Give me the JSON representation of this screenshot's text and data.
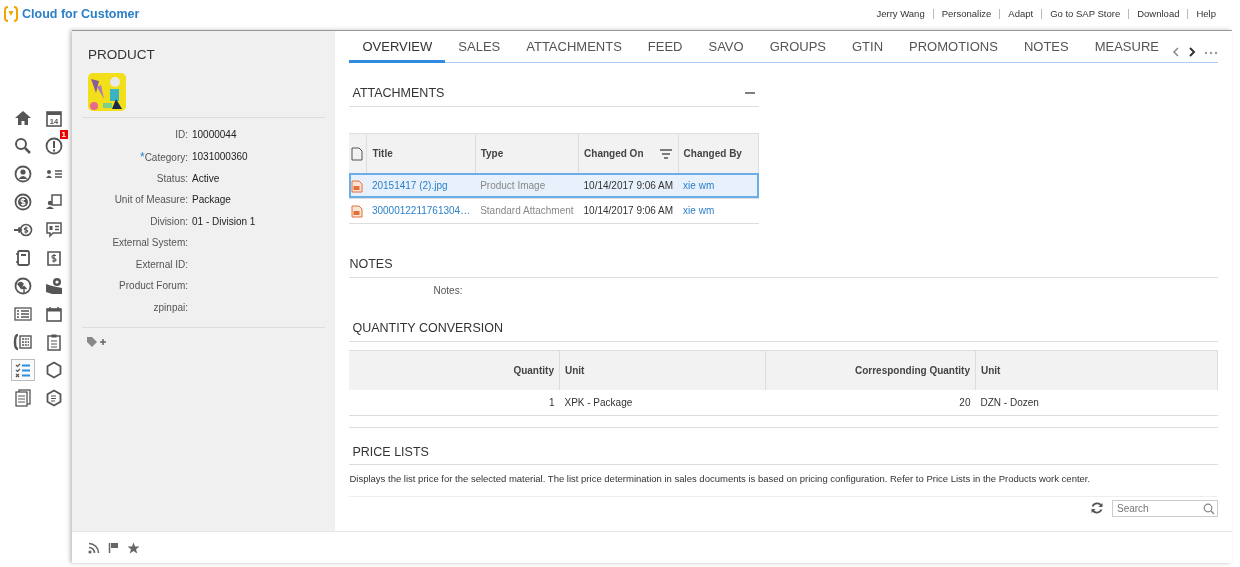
{
  "header": {
    "app_title": "Cloud for Customer",
    "links": [
      "Jerry Wang",
      "Personalize",
      "Adapt",
      "Go to SAP Store",
      "Download",
      "Help"
    ]
  },
  "sidebar": {
    "items": [
      {
        "kind": "home",
        "selected": false
      },
      {
        "kind": "calendar",
        "selected": false,
        "date": "14"
      },
      {
        "kind": "search",
        "selected": false
      },
      {
        "kind": "alert",
        "selected": false,
        "badge": "1"
      },
      {
        "kind": "person",
        "selected": false
      },
      {
        "kind": "people-list",
        "selected": false
      },
      {
        "kind": "money",
        "selected": false
      },
      {
        "kind": "person-chart",
        "selected": false
      },
      {
        "kind": "money-in",
        "selected": false
      },
      {
        "kind": "chat-money",
        "selected": false
      },
      {
        "kind": "notebook",
        "selected": false
      },
      {
        "kind": "money-doc",
        "selected": false
      },
      {
        "kind": "globe",
        "selected": false
      },
      {
        "kind": "map-pin",
        "selected": false
      },
      {
        "kind": "list",
        "selected": false
      },
      {
        "kind": "calendar-blank",
        "selected": false
      },
      {
        "kind": "phone",
        "selected": false
      },
      {
        "kind": "clipboard",
        "selected": false
      },
      {
        "kind": "checklist",
        "selected": true
      },
      {
        "kind": "cube",
        "selected": false
      },
      {
        "kind": "documents",
        "selected": false
      },
      {
        "kind": "cube-doc",
        "selected": false
      }
    ]
  },
  "product": {
    "title": "PRODUCT",
    "fields": [
      {
        "label": "ID:",
        "value": "10000044"
      },
      {
        "label": "Category:",
        "value": "1031000360",
        "required_mark": "*"
      },
      {
        "label": "Status:",
        "value": "Active"
      },
      {
        "label": "Unit of Measure:",
        "value": "Package"
      },
      {
        "label": "Division:",
        "value": "01 - Division 1"
      },
      {
        "label": "External System:"
      },
      {
        "label": "External ID:"
      },
      {
        "label": "Product Forum:"
      },
      {
        "label": "zpinpai:"
      }
    ]
  },
  "tabs": [
    {
      "label": "OVERVIEW",
      "selected": true
    },
    {
      "label": "SALES",
      "selected": false
    },
    {
      "label": "ATTACHMENTS",
      "selected": false
    },
    {
      "label": "FEED",
      "selected": false
    },
    {
      "label": "SAVO",
      "selected": false
    },
    {
      "label": "GROUPS",
      "selected": false
    },
    {
      "label": "GTIN",
      "selected": false
    },
    {
      "label": "PROMOTIONS",
      "selected": false
    },
    {
      "label": "NOTES",
      "selected": false
    },
    {
      "label": "MEASURE",
      "selected": false
    }
  ],
  "attachments": {
    "title": "ATTACHMENTS",
    "columns": [
      "Title",
      "Type",
      "Changed On",
      "Changed By"
    ],
    "rows": [
      {
        "title": "20151417 (2).jpg",
        "type": "Product Image",
        "changed_on": "10/14/2017 9:06 AM",
        "changed_by": "xie wm",
        "selected": true
      },
      {
        "title": "3000012211761304…",
        "type": "Standard Attachment",
        "changed_on": "10/14/2017 9:06 AM",
        "changed_by": "xie wm",
        "selected": false
      }
    ]
  },
  "notes": {
    "title": "NOTES",
    "label": "Notes:"
  },
  "quantity_conversion": {
    "title": "QUANTITY CONVERSION",
    "columns": [
      "Quantity",
      "Unit",
      "Corresponding Quantity",
      "Unit"
    ],
    "rows": [
      [
        "1",
        "XPK - Package",
        "20",
        "DZN - Dozen"
      ]
    ]
  },
  "price_lists": {
    "title": "PRICE LISTS",
    "description": "Displays the list price for the selected material. The list price determination in sales documents is based on pricing configuration. Refer to Price Lists in the Products work center.",
    "search": {
      "placeholder": "Search"
    }
  }
}
